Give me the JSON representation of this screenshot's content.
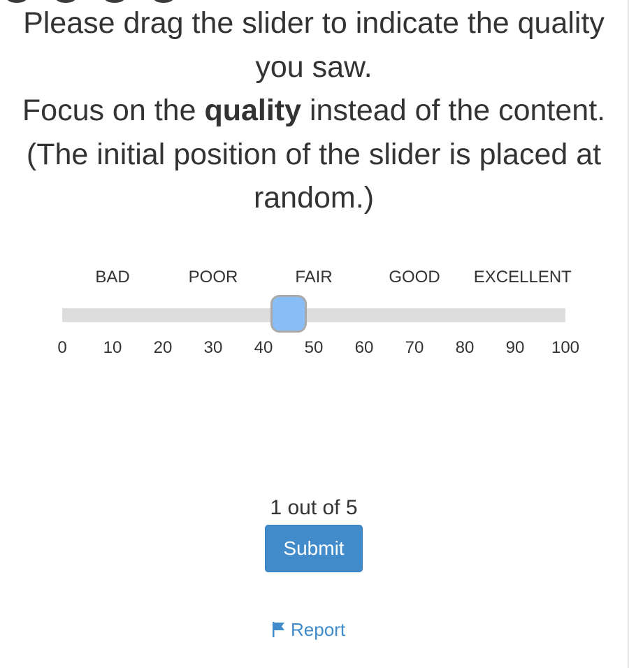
{
  "instructions": {
    "line1": "Please drag the slider to indicate the quality you saw.",
    "line2_prefix": "Focus on the",
    "line2_bold": "quality",
    "line2_suffix": "instead of the content.",
    "line3": "(The initial position of the slider is placed at random.)"
  },
  "slider": {
    "min": 0,
    "max": 100,
    "value": 45,
    "categories": [
      {
        "label": "BAD",
        "value": 10
      },
      {
        "label": "POOR",
        "value": 30
      },
      {
        "label": "FAIR",
        "value": 50
      },
      {
        "label": "GOOD",
        "value": 70
      },
      {
        "label": "EXCELLENT",
        "value": 91.5
      }
    ],
    "ticks": [
      "0",
      "10",
      "20",
      "30",
      "40",
      "50",
      "60",
      "70",
      "80",
      "90",
      "100"
    ],
    "colors": {
      "track": "#dddddd",
      "handle_fill": "#89bdf6",
      "handle_border": "#aaaaaa"
    }
  },
  "footer": {
    "progress": "1 out of 5",
    "submit_label": "Submit",
    "report_label": "Report",
    "report_icon": "flag-icon",
    "accent_color": "#428bca"
  }
}
